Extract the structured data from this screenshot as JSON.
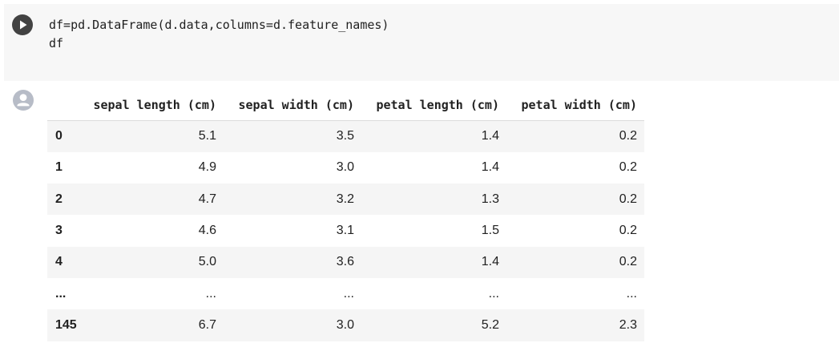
{
  "code_cell": {
    "run_button_icon": "play-icon",
    "lines": [
      "df=pd.DataFrame(d.data,columns=d.feature_names)",
      "df"
    ]
  },
  "output": {
    "avatar_icon": "user-avatar-icon",
    "dataframe": {
      "columns": [
        "sepal length (cm)",
        "sepal width (cm)",
        "petal length (cm)",
        "petal width (cm)"
      ],
      "rows": [
        {
          "index": "0",
          "values": [
            "5.1",
            "3.5",
            "1.4",
            "0.2"
          ]
        },
        {
          "index": "1",
          "values": [
            "4.9",
            "3.0",
            "1.4",
            "0.2"
          ]
        },
        {
          "index": "2",
          "values": [
            "4.7",
            "3.2",
            "1.3",
            "0.2"
          ]
        },
        {
          "index": "3",
          "values": [
            "4.6",
            "3.1",
            "1.5",
            "0.2"
          ]
        },
        {
          "index": "4",
          "values": [
            "5.0",
            "3.6",
            "1.4",
            "0.2"
          ]
        },
        {
          "index": "...",
          "values": [
            "...",
            "...",
            "...",
            "..."
          ]
        },
        {
          "index": "145",
          "values": [
            "6.7",
            "3.0",
            "5.2",
            "2.3"
          ]
        }
      ]
    }
  }
}
